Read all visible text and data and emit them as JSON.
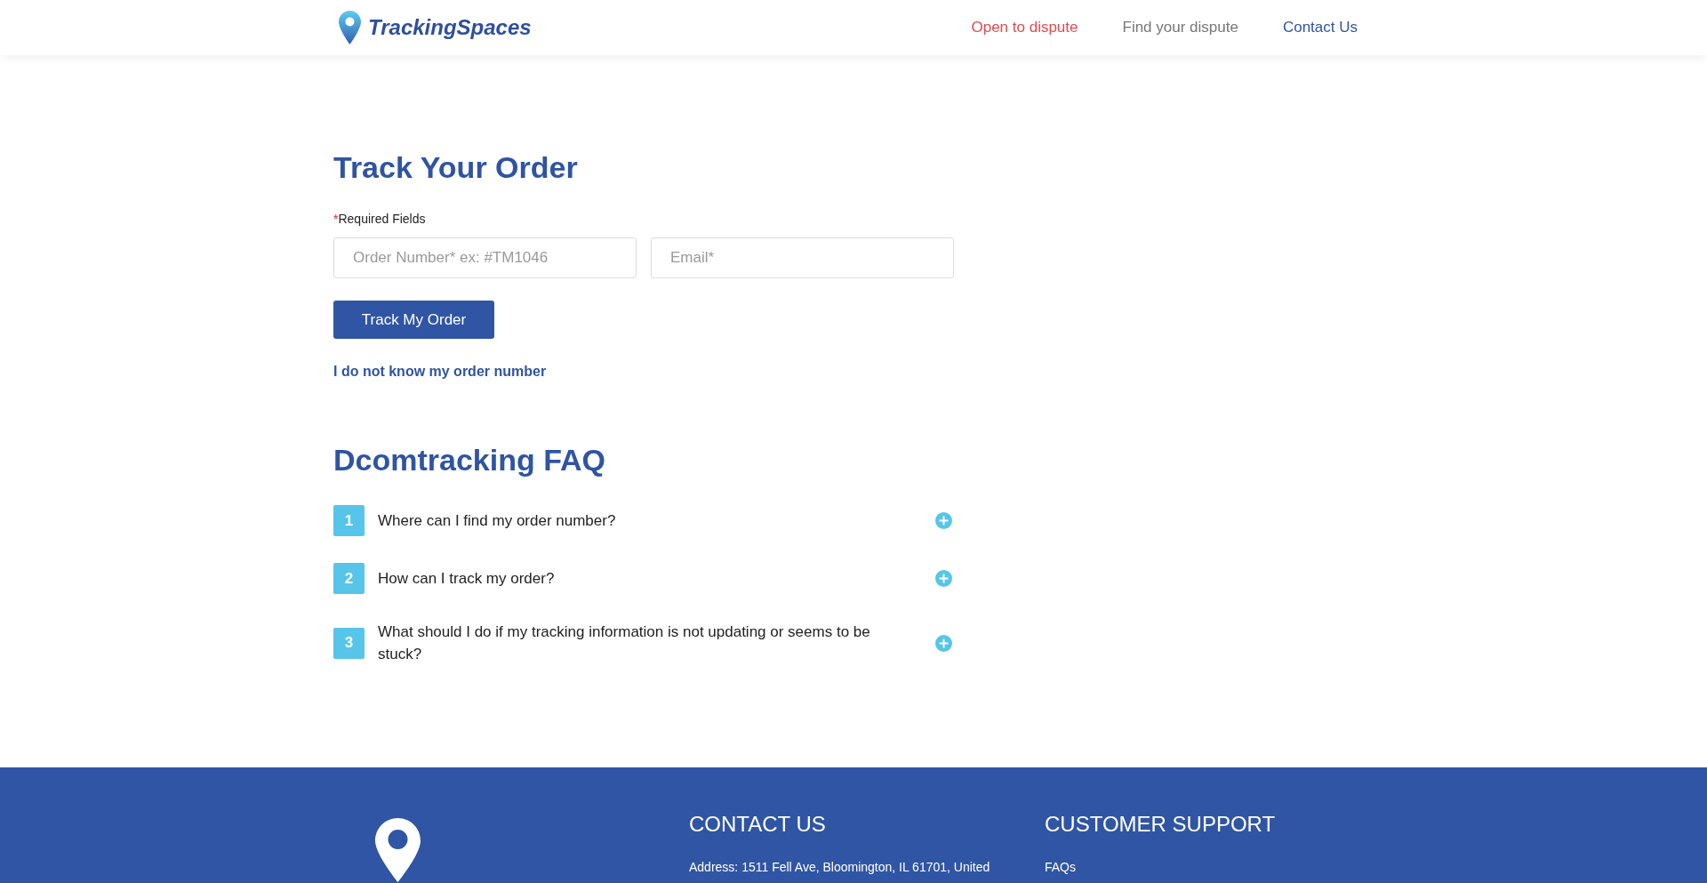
{
  "header": {
    "logo": {
      "text": "TrackingSpaces"
    },
    "nav": [
      {
        "label": "Open to dispute",
        "color": "#e04a4e"
      },
      {
        "label": "Find your dispute",
        "color": "#777777"
      },
      {
        "label": "Contact Us",
        "color": "#2f54a3"
      }
    ]
  },
  "track_form": {
    "title": "Track Your Order",
    "required_note": {
      "marker": "*",
      "text": "Required Fields"
    },
    "fields": [
      {
        "placeholder": "Order Number* ex: #TM1046"
      },
      {
        "placeholder": "Email*"
      }
    ],
    "submit_button": "Track My Order",
    "help_link": "I do not know my order number"
  },
  "faq": {
    "title": "Dcomtracking FAQ",
    "items": [
      {
        "number": "1",
        "question": "Where can I find my order number?",
        "expanded": false
      },
      {
        "number": "2",
        "question": "How can I track my order?",
        "expanded": false
      },
      {
        "number": "3",
        "question": "What should I do if my tracking information is not updating or seems to be stuck?",
        "expanded": false
      }
    ]
  },
  "footer": {
    "contact": {
      "heading": "CONTACT US",
      "address": "Address: 1511 Fell Ave, Bloomington, IL 61701, United"
    },
    "support": {
      "heading": "CUSTOMER SUPPORT",
      "links": [
        "FAQs"
      ]
    }
  }
}
